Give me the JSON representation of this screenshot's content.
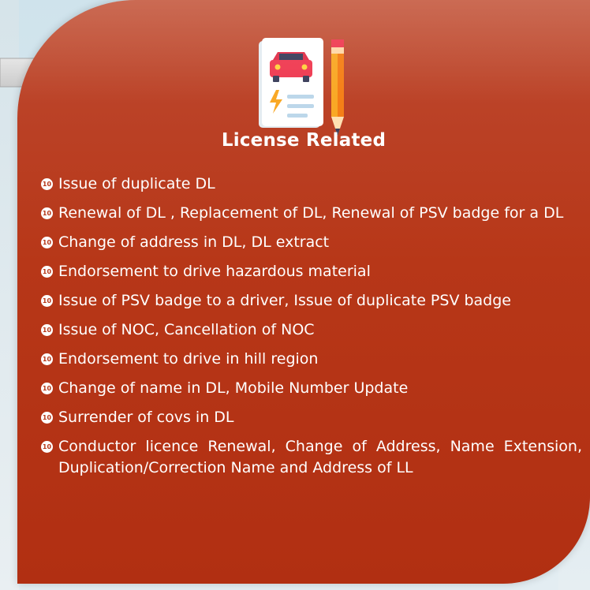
{
  "section": {
    "title": "License Related",
    "icon": "license-document-car-pencil-icon"
  },
  "colors": {
    "card": "#b73718",
    "text": "#ffffff",
    "arrow": "#d3d3d3"
  },
  "bullet_glyph": "10",
  "items": [
    {
      "label": "Issue of duplicate DL"
    },
    {
      "label": "Renewal of DL , Replacement of DL, Renewal of PSV badge for a DL"
    },
    {
      "label": "Change of address in DL, DL extract"
    },
    {
      "label": "Endorsement to drive hazardous material"
    },
    {
      "label": "Issue of PSV badge to a driver, Issue of duplicate PSV badge"
    },
    {
      "label": "Issue of NOC, Cancellation of NOC"
    },
    {
      "label": "Endorsement to drive in hill region"
    },
    {
      "label": "Change of name in DL, Mobile Number Update"
    },
    {
      "label": "Surrender of covs in DL"
    },
    {
      "label": "Conductor licence Renewal, Change of Address, Name Extension, Duplication/Correction Name and Address of LL"
    }
  ]
}
